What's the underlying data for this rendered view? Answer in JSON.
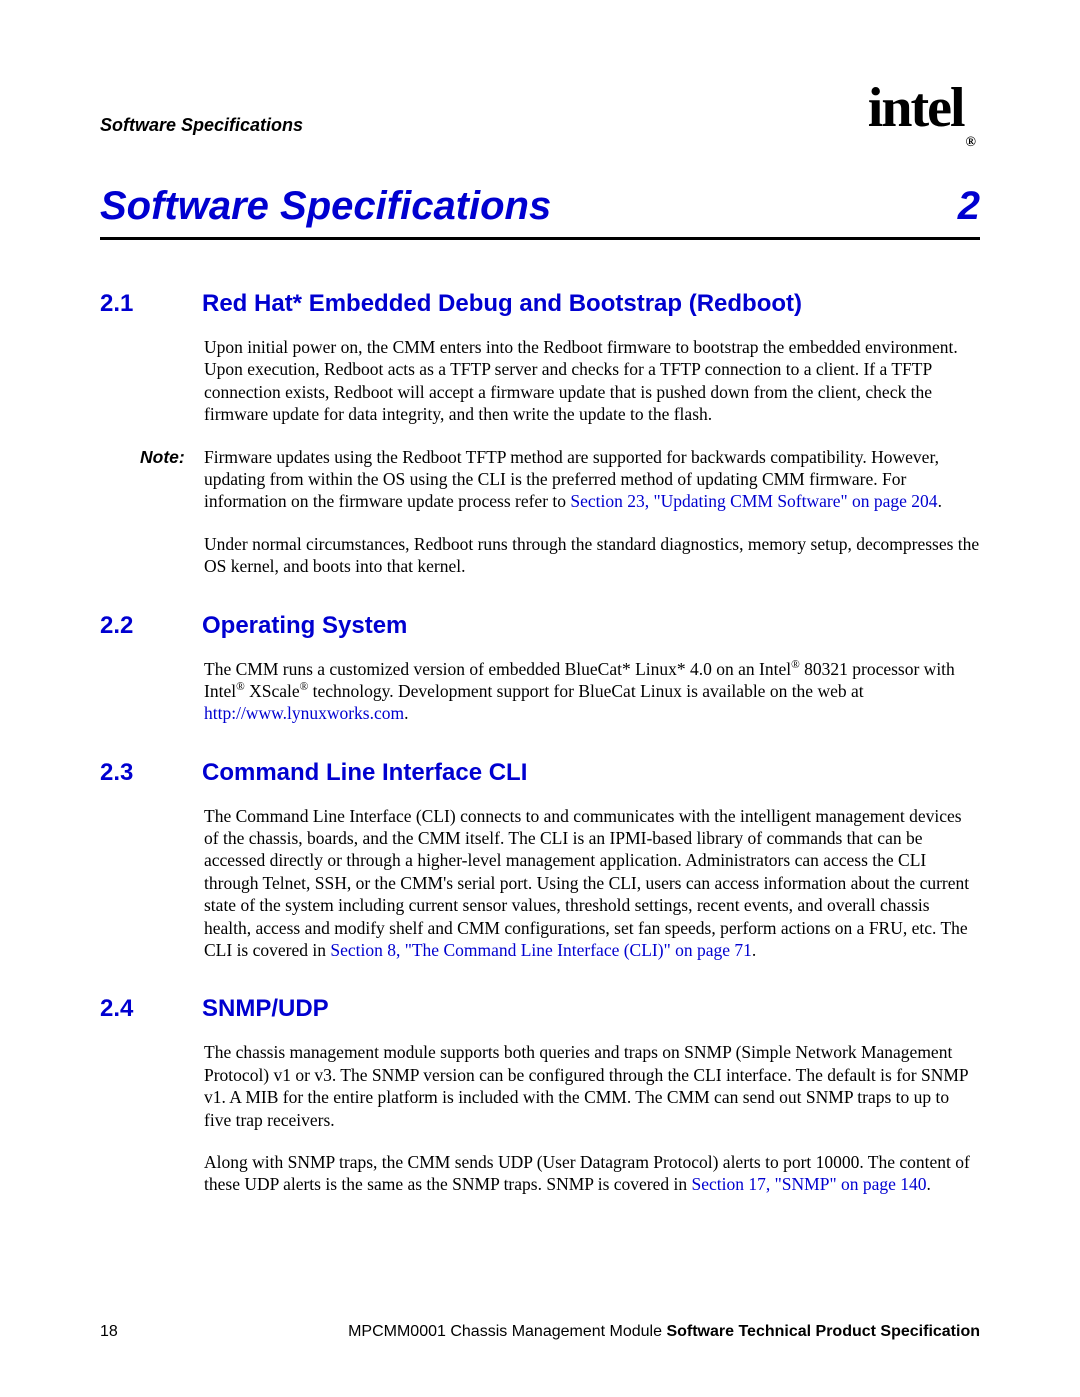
{
  "header": {
    "running_head": "Software Specifications",
    "logo_text": "intel",
    "logo_reg": "®"
  },
  "chapter": {
    "title": "Software Specifications",
    "number": "2"
  },
  "sections": {
    "s1": {
      "num": "2.1",
      "title": "Red Hat* Embedded Debug and Bootstrap (Redboot)",
      "p1": "Upon initial power on, the CMM enters into the Redboot firmware to bootstrap the embedded environment. Upon execution, Redboot acts as a TFTP server and checks for a TFTP connection to a client. If a TFTP connection exists, Redboot will accept a firmware update that is pushed down from the client, check the firmware update for data integrity, and then write the update to the flash.",
      "note_label": "Note:",
      "note_a": "Firmware updates using the Redboot TFTP method are supported for backwards compatibility. However, updating from within the OS using the CLI is the preferred method of updating CMM firmware. For information on the firmware update process refer to ",
      "note_xref": "Section 23, \"Updating CMM Software\" on page 204",
      "note_b": ".",
      "p2": "Under normal circumstances, Redboot runs through the standard diagnostics, memory setup, decompresses the OS kernel, and boots into that kernel."
    },
    "s2": {
      "num": "2.2",
      "title": "Operating System",
      "p1a": "The CMM runs a customized version of embedded BlueCat* Linux* 4.0 on an Intel",
      "p1b": " 80321 processor with Intel",
      "p1c": " XScale",
      "p1d": " technology. Development support for BlueCat Linux is available on the web at ",
      "p1_link": "http://www.lynuxworks.com",
      "p1e": "."
    },
    "s3": {
      "num": "2.3",
      "title": "Command Line Interface CLI",
      "p1a": "The Command Line Interface (CLI) connects to and communicates with the intelligent management devices of the chassis, boards, and the CMM itself. The CLI is an IPMI-based library of commands that can be accessed directly or through a higher-level management application. Administrators can access the CLI through Telnet, SSH, or the CMM's serial port. Using the CLI, users can access information about the current state of the system including current sensor values, threshold settings, recent events, and overall chassis health, access and modify shelf and CMM configurations, set fan speeds, perform actions on a FRU, etc. The CLI is covered in ",
      "p1_xref": "Section 8, \"The Command Line Interface (CLI)\" on page 71",
      "p1b": "."
    },
    "s4": {
      "num": "2.4",
      "title": "SNMP/UDP",
      "p1": "The chassis management module supports both queries and traps on SNMP (Simple Network Management Protocol) v1 or v3. The SNMP version can be configured through the CLI interface. The default is for SNMP v1. A MIB for the entire platform is included with the CMM. The CMM can send out SNMP traps to up to five trap receivers.",
      "p2a": "Along with SNMP traps, the CMM sends UDP (User Datagram Protocol) alerts to port 10000. The content of these UDP alerts is the same as the SNMP traps. SNMP is covered in ",
      "p2_xref": "Section 17, \"SNMP\" on page 140",
      "p2b": "."
    }
  },
  "footer": {
    "page_number": "18",
    "doc_prefix": "MPCMM0001 Chassis Management Module ",
    "doc_bold": "Software Technical Product Specification"
  },
  "sup_reg": "®"
}
